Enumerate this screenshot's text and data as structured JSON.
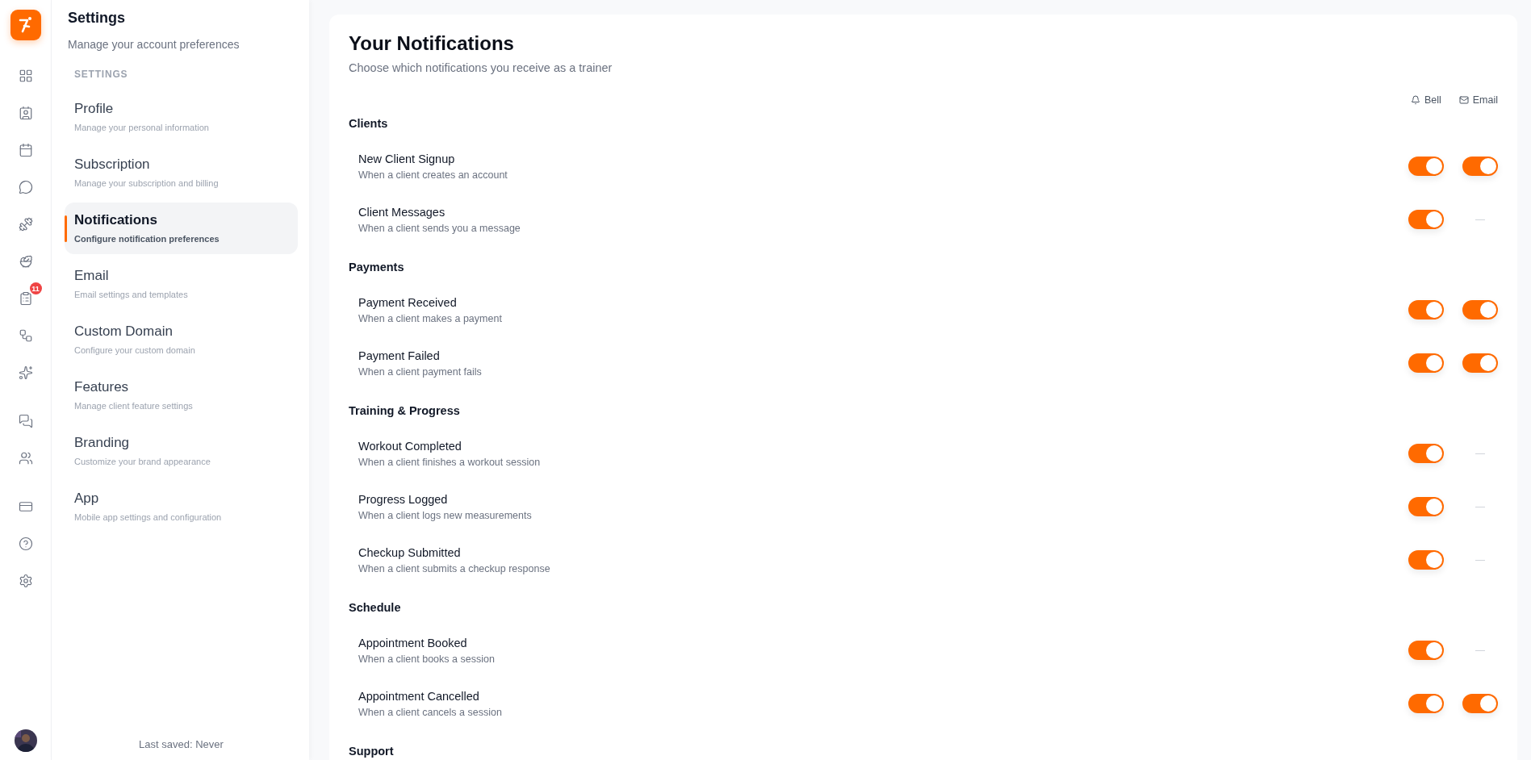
{
  "rail": {
    "items": [
      {
        "kind": "grid",
        "selected": false
      },
      {
        "kind": "contacts",
        "selected": false
      },
      {
        "kind": "calendar",
        "selected": false
      },
      {
        "kind": "chat",
        "selected": false
      },
      {
        "kind": "dumbbell",
        "selected": false
      },
      {
        "kind": "salad",
        "selected": false
      },
      {
        "kind": "clipboard",
        "selected": false,
        "badge": "11"
      },
      {
        "kind": "workflow",
        "selected": false
      },
      {
        "kind": "sparkles",
        "selected": false
      },
      {
        "kind": "messages",
        "selected": false
      },
      {
        "kind": "team",
        "selected": false
      },
      {
        "kind": "card",
        "selected": false
      },
      {
        "kind": "help",
        "selected": false
      },
      {
        "kind": "settings",
        "selected": false
      }
    ]
  },
  "sidebar": {
    "title": "Settings",
    "subtitle": "Manage your account preferences",
    "section": "SETTINGS",
    "items": [
      {
        "label": "Profile",
        "description": "Manage your personal information",
        "selected": false
      },
      {
        "label": "Subscription",
        "description": "Manage your subscription and billing",
        "selected": false
      },
      {
        "label": "Notifications",
        "description": "Configure notification preferences",
        "selected": true
      },
      {
        "label": "Email",
        "description": "Email settings and templates",
        "selected": false
      },
      {
        "label": "Custom Domain",
        "description": "Configure your custom domain",
        "selected": false
      },
      {
        "label": "Features",
        "description": "Manage client feature settings",
        "selected": false
      },
      {
        "label": "Branding",
        "description": "Customize your brand appearance",
        "selected": false
      },
      {
        "label": "App",
        "description": "Mobile app settings and configuration",
        "selected": false
      }
    ],
    "footer": "Last saved: Never"
  },
  "main": {
    "title": "Your Notifications",
    "subtitle": "Choose which notifications you receive as a trainer",
    "columns": [
      {
        "kind": "bell",
        "label": "Bell"
      },
      {
        "kind": "email",
        "label": "Email"
      }
    ],
    "sections": [
      {
        "title": "Clients",
        "items": [
          {
            "title": "New Client Signup",
            "description": "When a client creates an account",
            "channels": [
              {
                "kind": "toggle",
                "on": true
              },
              {
                "kind": "toggle",
                "on": true
              }
            ]
          },
          {
            "title": "Client Messages",
            "description": "When a client sends you a message",
            "channels": [
              {
                "kind": "toggle",
                "on": true
              },
              {
                "kind": "unavailable"
              }
            ]
          }
        ]
      },
      {
        "title": "Payments",
        "items": [
          {
            "title": "Payment Received",
            "description": "When a client makes a payment",
            "channels": [
              {
                "kind": "toggle",
                "on": true
              },
              {
                "kind": "toggle",
                "on": true
              }
            ]
          },
          {
            "title": "Payment Failed",
            "description": "When a client payment fails",
            "channels": [
              {
                "kind": "toggle",
                "on": true
              },
              {
                "kind": "toggle",
                "on": true
              }
            ]
          }
        ]
      },
      {
        "title": "Training & Progress",
        "items": [
          {
            "title": "Workout Completed",
            "description": "When a client finishes a workout session",
            "channels": [
              {
                "kind": "toggle",
                "on": true
              },
              {
                "kind": "unavailable"
              }
            ]
          },
          {
            "title": "Progress Logged",
            "description": "When a client logs new measurements",
            "channels": [
              {
                "kind": "toggle",
                "on": true
              },
              {
                "kind": "unavailable"
              }
            ]
          },
          {
            "title": "Checkup Submitted",
            "description": "When a client submits a checkup response",
            "channels": [
              {
                "kind": "toggle",
                "on": true
              },
              {
                "kind": "unavailable"
              }
            ]
          }
        ]
      },
      {
        "title": "Schedule",
        "items": [
          {
            "title": "Appointment Booked",
            "description": "When a client books a session",
            "channels": [
              {
                "kind": "toggle",
                "on": true
              },
              {
                "kind": "unavailable"
              }
            ]
          },
          {
            "title": "Appointment Cancelled",
            "description": "When a client cancels a session",
            "channels": [
              {
                "kind": "toggle",
                "on": true
              },
              {
                "kind": "toggle",
                "on": true
              }
            ]
          }
        ]
      },
      {
        "title": "Support"
      }
    ]
  }
}
